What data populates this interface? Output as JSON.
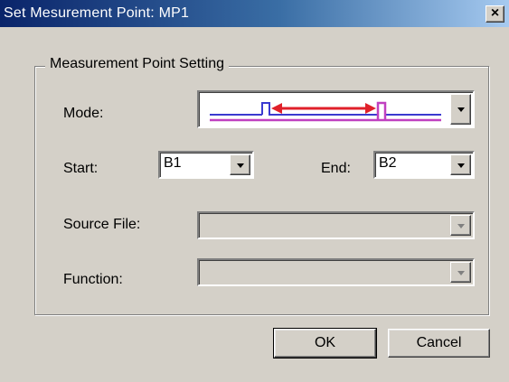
{
  "window": {
    "title": "Set Mesurement Point: MP1",
    "close_glyph": "×"
  },
  "group": {
    "legend": "Measurement Point Setting"
  },
  "mode": {
    "label": "Mode:",
    "icon": "pulse-interval-icon"
  },
  "start": {
    "label": "Start:",
    "value": "B1"
  },
  "end": {
    "label": "End:",
    "value": "B2"
  },
  "source_file": {
    "label": "Source File:",
    "value": "",
    "enabled": false
  },
  "function": {
    "label": "Function:",
    "value": "",
    "enabled": false
  },
  "buttons": {
    "ok": "OK",
    "cancel": "Cancel"
  },
  "colors": {
    "title_bar_start": "#0a246a",
    "arrow": "#e0202a",
    "pulse_blue": "#3a3ad0",
    "pulse_magenta": "#c040c0"
  }
}
